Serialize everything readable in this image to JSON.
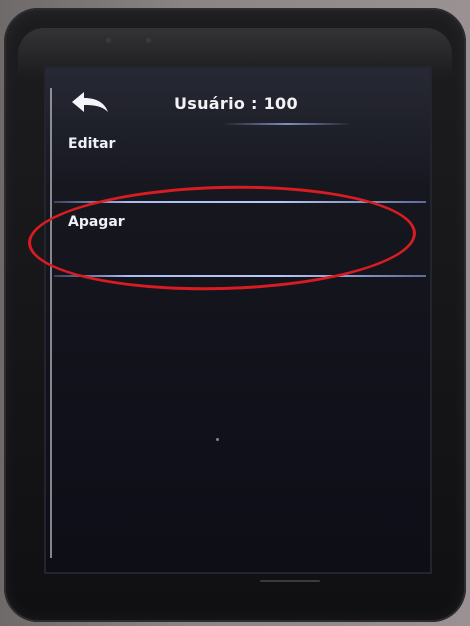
{
  "header": {
    "title": "Usuário : 100",
    "back_icon": "back-arrow-icon"
  },
  "menu": {
    "items": [
      {
        "label": "Editar"
      },
      {
        "label": "Apagar"
      }
    ]
  },
  "colors": {
    "screen_bg": "#13141c",
    "text": "#eef0f6",
    "divider": "#a9bdf2",
    "annotation_ring": "#d81c22",
    "bezel": "#1a1a1c"
  }
}
